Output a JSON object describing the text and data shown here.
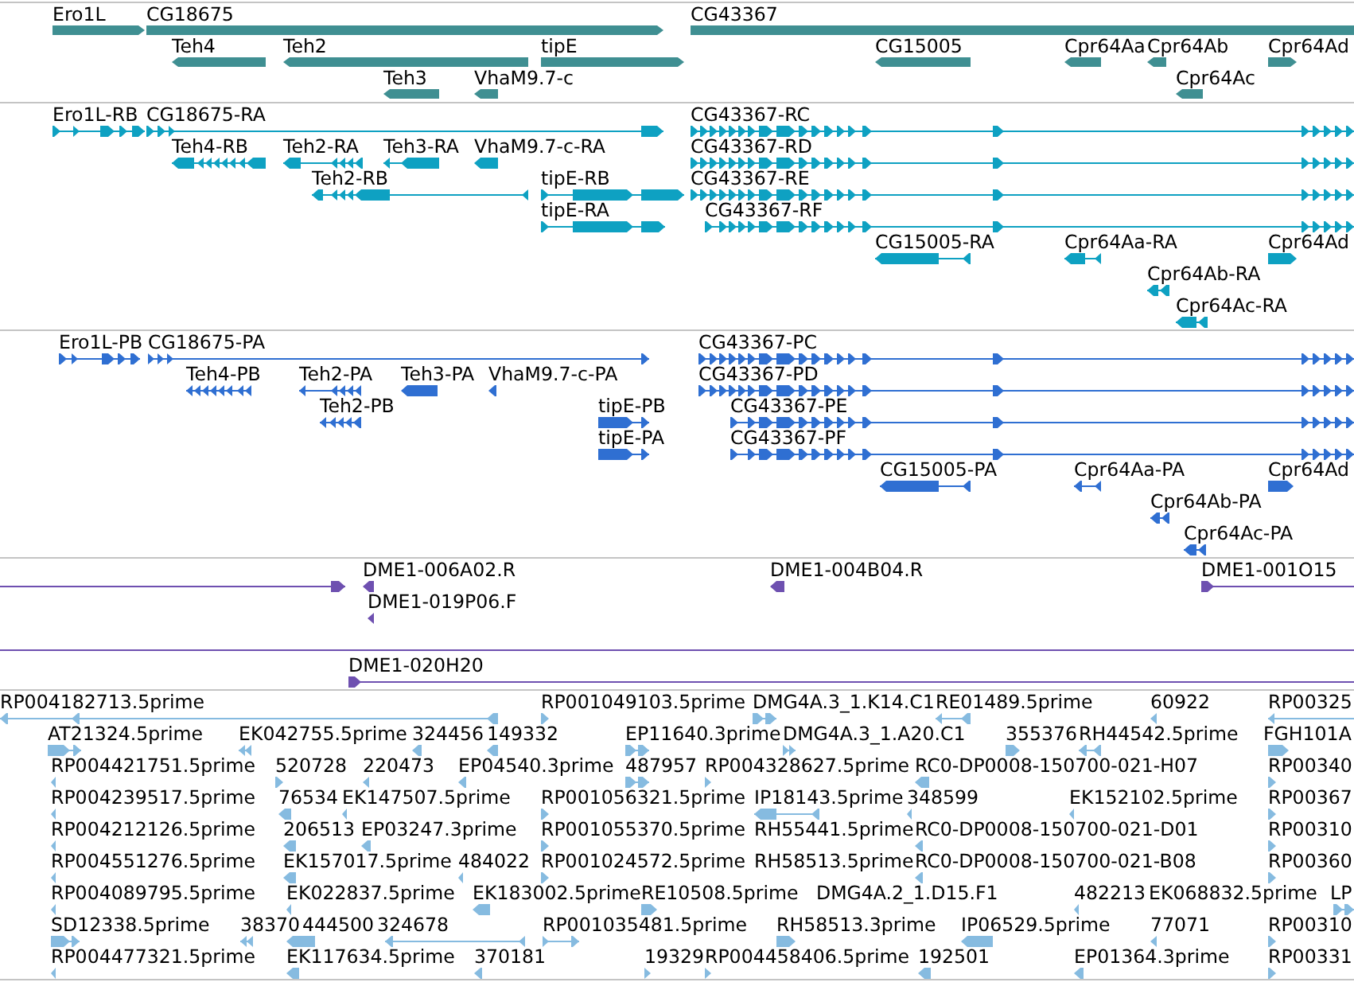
{
  "tracks": [
    {
      "kind": "gene",
      "lanes": [
        [
          {
            "label": "Ero1L",
            "reverse": false
          },
          {
            "label": "CG18675",
            "reverse": false
          },
          {
            "label": "CG43367"
          }
        ],
        [
          {
            "label": "Teh4",
            "reverse": true
          },
          {
            "label": "Teh2",
            "reverse": true
          },
          {
            "label": "tipE",
            "reverse": false
          },
          {
            "label": "CG15005",
            "reverse": true
          },
          {
            "label": "Cpr64Aa",
            "reverse": true
          },
          {
            "label": "Cpr64Ab",
            "reverse": true
          },
          {
            "label": "Cpr64Ad",
            "reverse": false
          }
        ],
        [
          {
            "label": "Teh3",
            "reverse": true
          },
          {
            "label": "VhaM9.7-c",
            "reverse": true
          },
          {
            "label": "Cpr64Ac",
            "reverse": true
          }
        ]
      ]
    },
    {
      "kind": "transcript",
      "lanes": [
        [
          {
            "label": "Ero1L-RB",
            "reverse": false
          },
          {
            "label": "CG18675-RA",
            "reverse": false
          },
          {
            "label": "CG43367-RC",
            "reverse": false
          }
        ],
        [
          {
            "label": "Teh4-RB",
            "reverse": true
          },
          {
            "label": "Teh2-RA",
            "reverse": true
          },
          {
            "label": "Teh3-RA",
            "reverse": true
          },
          {
            "label": "VhaM9.7-c-RA",
            "reverse": true
          },
          {
            "label": "CG43367-RD",
            "reverse": false
          }
        ],
        [
          {
            "label": "Teh2-RB",
            "reverse": true
          },
          {
            "label": "tipE-RB",
            "reverse": false
          },
          {
            "label": "CG43367-RE",
            "reverse": false
          }
        ],
        [
          {
            "label": "tipE-RA",
            "reverse": false
          },
          {
            "label": "CG43367-RF",
            "reverse": false
          }
        ],
        [
          {
            "label": "CG15005-RA",
            "reverse": true
          },
          {
            "label": "Cpr64Aa-RA",
            "reverse": true
          },
          {
            "label": "Cpr64Ad",
            "reverse": false
          }
        ],
        [
          {
            "label": "Cpr64Ab-RA",
            "reverse": true
          }
        ],
        [
          {
            "label": "Cpr64Ac-RA",
            "reverse": true
          }
        ]
      ]
    },
    {
      "kind": "protein",
      "lanes": [
        [
          {
            "label": "Ero1L-PB",
            "reverse": false
          },
          {
            "label": "CG18675-PA",
            "reverse": false
          },
          {
            "label": "CG43367-PC",
            "reverse": false
          }
        ],
        [
          {
            "label": "Teh4-PB",
            "reverse": true
          },
          {
            "label": "Teh2-PA",
            "reverse": true
          },
          {
            "label": "Teh3-PA",
            "reverse": true
          },
          {
            "label": "VhaM9.7-c-PA",
            "reverse": true
          },
          {
            "label": "CG43367-PD",
            "reverse": false
          }
        ],
        [
          {
            "label": "Teh2-PB",
            "reverse": true
          },
          {
            "label": "tipE-PB",
            "reverse": false
          },
          {
            "label": "CG43367-PE",
            "reverse": false
          }
        ],
        [
          {
            "label": "tipE-PA",
            "reverse": false
          },
          {
            "label": "CG43367-PF",
            "reverse": false
          }
        ],
        [
          {
            "label": "CG15005-PA",
            "reverse": true
          },
          {
            "label": "Cpr64Aa-PA",
            "reverse": true
          },
          {
            "label": "Cpr64Ad",
            "reverse": false
          }
        ],
        [
          {
            "label": "Cpr64Ab-PA",
            "reverse": true
          }
        ],
        [
          {
            "label": "Cpr64Ac-PA",
            "reverse": true
          }
        ]
      ]
    },
    {
      "kind": "clone",
      "lanes": [
        [
          {
            "reverse": false
          },
          {
            "label": "DME1-006A02.R",
            "reverse": true
          },
          {
            "label": "DME1-004B04.R",
            "reverse": true
          },
          {
            "label": "DME1-001O15",
            "reverse": false
          }
        ],
        [
          {
            "label": "DME1-019P06.F",
            "reverse": true
          }
        ],
        [
          {
            "clipped": true
          }
        ],
        [
          {
            "label": "DME1-020H20",
            "reverse": false
          }
        ]
      ]
    },
    {
      "kind": "est",
      "lanes": [
        [
          {
            "label": "RP004182713.5prime",
            "reverse": true
          },
          {
            "label": "RP001049103.5prime",
            "reverse": false
          },
          {
            "label": "DMG4A.3_1.K14.C1",
            "reverse": false
          },
          {
            "label": "RE01489.5prime",
            "reverse": true
          },
          {
            "label": "60922",
            "reverse": true
          },
          {
            "label": "RP00325",
            "reverse": true
          }
        ],
        [
          {
            "label": "AT21324.5prime",
            "reverse": false
          },
          {
            "label": "EK042755.5prime",
            "reverse": true
          },
          {
            "label": "324456",
            "reverse": true
          },
          {
            "label": "149332",
            "reverse": true
          },
          {
            "label": "EP11640.3prime",
            "reverse": false
          },
          {
            "label": "DMG4A.3_1.A20.C1",
            "reverse": false
          },
          {
            "label": "355376",
            "reverse": false
          },
          {
            "label": "RH44542.5prime",
            "reverse": true
          },
          {
            "label": "FGH101A",
            "reverse": false
          }
        ],
        [
          {
            "label": "RP004421751.5prime",
            "reverse": true
          },
          {
            "label": "520728",
            "reverse": false
          },
          {
            "label": "220473",
            "reverse": true
          },
          {
            "label": "EP04540.3prime",
            "reverse": true
          },
          {
            "label": "487957",
            "reverse": false
          },
          {
            "label": "RP004328627.5prime",
            "reverse": false
          },
          {
            "label": "RC0-DP0008-150700-021-H07",
            "reverse": true
          },
          {
            "label": "RP00340",
            "reverse": false
          }
        ],
        [
          {
            "label": "RP004239517.5prime",
            "reverse": true
          },
          {
            "label": "76534",
            "reverse": true
          },
          {
            "label": "EK147507.5prime",
            "reverse": true
          },
          {
            "label": "RP001056321.5prime",
            "reverse": false
          },
          {
            "label": "IP18143.5prime",
            "reverse": true
          },
          {
            "label": "348599",
            "reverse": true
          },
          {
            "label": "EK152102.5prime",
            "reverse": true
          },
          {
            "label": "RP00367",
            "reverse": false
          }
        ],
        [
          {
            "label": "RP004212126.5prime",
            "reverse": true
          },
          {
            "label": "206513",
            "reverse": true
          },
          {
            "label": "EP03247.3prime",
            "reverse": true
          },
          {
            "label": "RP001055370.5prime",
            "reverse": false
          },
          {
            "label": "RH55441.5prime"
          },
          {
            "label": "RC0-DP0008-150700-021-D01",
            "reverse": true
          },
          {
            "label": "RP00310",
            "reverse": false
          }
        ],
        [
          {
            "label": "RP004551276.5prime",
            "reverse": true
          },
          {
            "label": "EK157017.5prime",
            "reverse": true
          },
          {
            "label": "484022",
            "reverse": true
          },
          {
            "label": "RP001024572.5prime",
            "reverse": false
          },
          {
            "label": "RH58513.5prime"
          },
          {
            "label": "RC0-DP0008-150700-021-B08",
            "reverse": true
          },
          {
            "label": "RP00360",
            "reverse": false
          }
        ],
        [
          {
            "label": "RP004089795.5prime",
            "reverse": true
          },
          {
            "label": "EK022837.5prime",
            "reverse": true
          },
          {
            "label": "EK183002.5prime",
            "reverse": true
          },
          {
            "label": "RE10508.5prime",
            "reverse": false
          },
          {
            "label": "DMG4A.2_1.D15.F1"
          },
          {
            "label": "482213",
            "reverse": true
          },
          {
            "label": "EK068832.5prime"
          },
          {
            "label": "LP",
            "reverse": false
          }
        ],
        [
          {
            "label": "SD12338.5prime",
            "reverse": false
          },
          {
            "label": "38370",
            "reverse": true
          },
          {
            "label": "444500",
            "reverse": true
          },
          {
            "label": "324678",
            "reverse": true
          },
          {
            "label": "RP001035481.5prime",
            "reverse": false
          },
          {
            "label": "RH58513.3prime",
            "reverse": false
          },
          {
            "label": "IP06529.5prime",
            "reverse": true
          },
          {
            "label": "77071",
            "reverse": true
          },
          {
            "label": "RP00310",
            "reverse": false
          }
        ],
        [
          {
            "label": "RP004477321.5prime",
            "reverse": true
          },
          {
            "label": "EK117634.5prime",
            "reverse": true
          },
          {
            "label": "370181",
            "reverse": true
          },
          {
            "label": "19329",
            "reverse": false
          },
          {
            "label": "RP004458406.5prime",
            "reverse": false
          },
          {
            "label": "192501",
            "reverse": true
          },
          {
            "label": "EP01364.3prime",
            "reverse": true
          },
          {
            "label": "RP00331",
            "reverse": false
          }
        ]
      ]
    }
  ]
}
